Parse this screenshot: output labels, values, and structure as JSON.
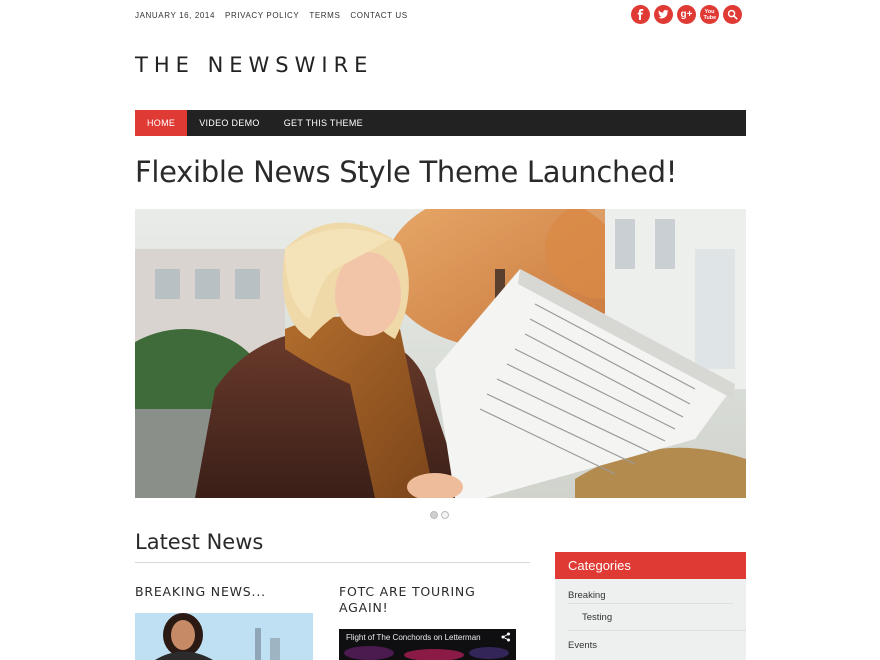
{
  "topbar": {
    "date": "JANUARY 16, 2014",
    "links": [
      "PRIVACY POLICY",
      "TERMS",
      "CONTACT US"
    ]
  },
  "social": {
    "icons": [
      "facebook-icon",
      "twitter-icon",
      "google-plus-icon",
      "youtube-icon",
      "search-icon"
    ],
    "color": "#e03a35",
    "youtube_label": "You Tube",
    "gplus_label": "g+"
  },
  "site": {
    "title": "THE NEWSWIRE"
  },
  "nav": {
    "items": [
      "HOME",
      "VIDEO DEMO",
      "GET THIS THEME"
    ],
    "active": "HOME",
    "bg": "#222222",
    "accent": "#e03a35"
  },
  "hero": {
    "headline": "Flexible News Style Theme Launched!",
    "slides": 2,
    "active_slide": 1
  },
  "latest": {
    "title": "Latest News",
    "posts": [
      {
        "title": "BREAKING NEWS..."
      },
      {
        "title": "FOTC ARE TOURING AGAIN!",
        "video_title": "Flight of The Conchords on Letterman"
      }
    ]
  },
  "categories": {
    "title": "Categories",
    "items": [
      "Breaking",
      "Testing",
      "Events"
    ]
  }
}
